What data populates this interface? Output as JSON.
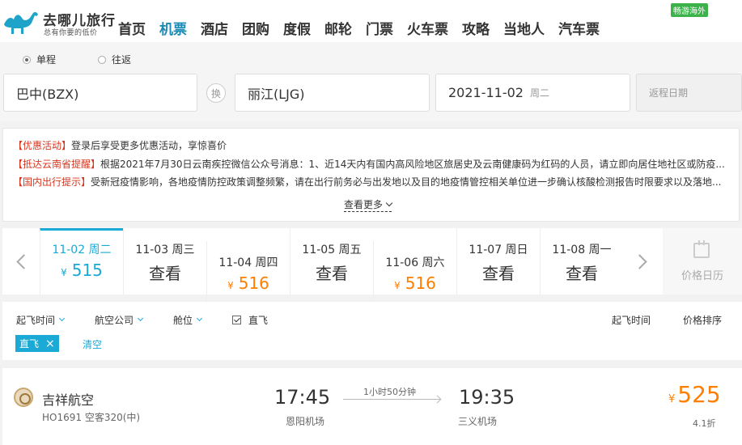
{
  "brand": {
    "name": "去哪儿旅行",
    "slogan": "总有你要的低价"
  },
  "nav": [
    "首页",
    "机票",
    "酒店",
    "团购",
    "度假",
    "邮轮",
    "门票",
    "火车票",
    "攻略",
    "当地人",
    "汽车票"
  ],
  "nav_active": "机票",
  "promo_badge": "畅游海外",
  "search": {
    "trip_types": [
      "单程",
      "往返"
    ],
    "trip_selected": "单程",
    "from": "巴中(BZX)",
    "swap_label": "换",
    "to": "丽江(LJG)",
    "depart_date": "2021-11-02",
    "depart_weekday": "周二",
    "return_placeholder": "返程日期"
  },
  "notices": [
    {
      "tag": "【优惠活动】",
      "text": "登录后享受更多优惠活动，享惊喜价"
    },
    {
      "tag": "【抵达云南省提醒】",
      "text": "根据2021年7月30日云南疾控微信公众号消息：1、近14天内有国内高风险地区旅居史及云南健康码为红码的人员，请立即向居住地社区或防疫..."
    },
    {
      "tag": "【国内出行提示】",
      "text": "受新冠疫情影响，各地疫情防控政策调整频繁，请在出行前务必与出发地以及目的地疫情管控相关单位进一步确认核酸检测报告时限要求以及落地..."
    }
  ],
  "notice_more": "查看更多",
  "date_bar": [
    {
      "date": "11-02 周二",
      "price": "515",
      "active": true
    },
    {
      "date": "11-03 周三",
      "price": "查看"
    },
    {
      "date": "11-04 周四",
      "price": "516"
    },
    {
      "date": "11-05 周五",
      "price": "查看"
    },
    {
      "date": "11-06 周六",
      "price": "516"
    },
    {
      "date": "11-07 周日",
      "price": "查看"
    },
    {
      "date": "11-08 周一",
      "price": "查看"
    }
  ],
  "currency": "¥",
  "calendar_label": "价格日历",
  "filters": {
    "depart_time": "起飞时间",
    "airline": "航空公司",
    "cabin": "舱位",
    "direct": "直飞",
    "sort_time": "起飞时间",
    "sort_price": "价格排序",
    "active_chip": "直飞",
    "chip_close": "×",
    "clear": "清空"
  },
  "flight": {
    "airline": "吉祥航空",
    "flight_no": "HO1691 空客320(中)",
    "depart_time": "17:45",
    "depart_airport": "恩阳机场",
    "duration": "1小时50分钟",
    "arrive_time": "19:35",
    "arrive_airport": "三义机场",
    "price": "525",
    "discount": "4.1折"
  },
  "colors": {
    "accent": "#1ba9d6",
    "price": "#ff7e00",
    "alert": "#d9361f",
    "badge": "#3bb34a"
  }
}
